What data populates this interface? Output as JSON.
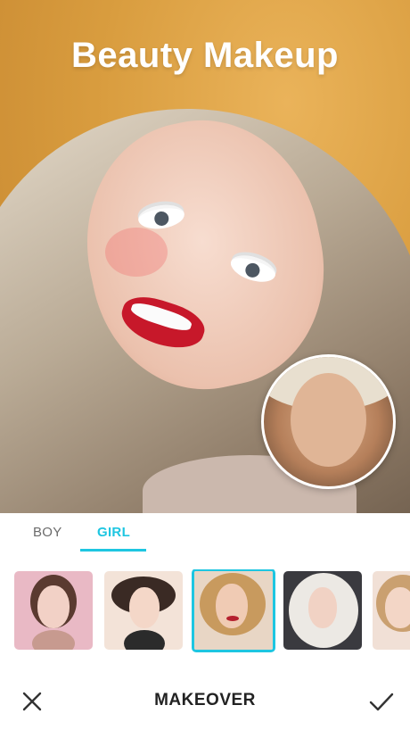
{
  "hero": {
    "title": "Beauty Makeup"
  },
  "tabs": [
    {
      "label": "BOY",
      "active": false
    },
    {
      "label": "GIRL",
      "active": true
    }
  ],
  "thumbnails": [
    {
      "id": "girl-1",
      "selected": false
    },
    {
      "id": "girl-2",
      "selected": false
    },
    {
      "id": "girl-3",
      "selected": true
    },
    {
      "id": "girl-4",
      "selected": false
    },
    {
      "id": "girl-5",
      "selected": false
    }
  ],
  "bottom_bar": {
    "title": "MAKEOVER",
    "close_icon": "close-icon",
    "confirm_icon": "checkmark-icon"
  },
  "colors": {
    "accent": "#1ec6e1",
    "background": "#d99d3f"
  }
}
